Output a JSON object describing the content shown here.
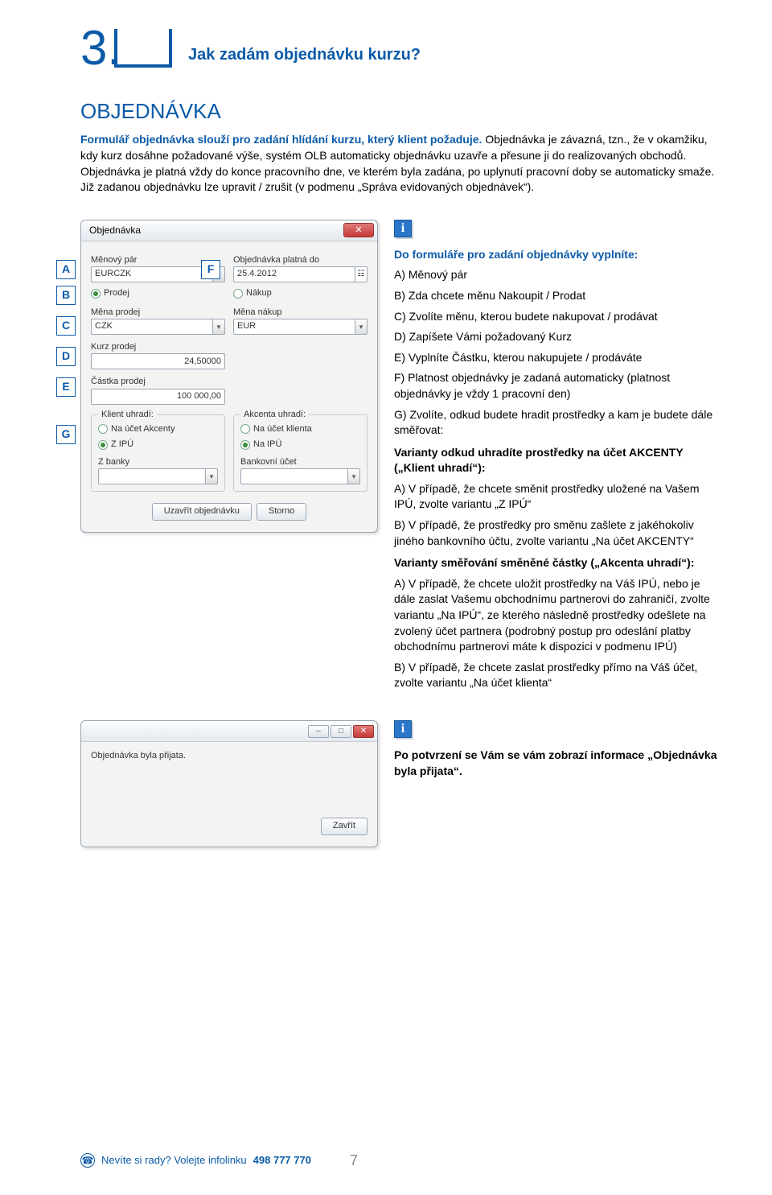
{
  "chapter": {
    "number": "3.",
    "title": "Jak zadám objednávku kurzu?"
  },
  "section": {
    "title": "OBJEDNÁVKA",
    "lead": "Formulář objednávka slouží pro zadání hlídání kurzu, který klient požaduje.",
    "body": "Objednávka je závazná, tzn., že v okamžiku, kdy kurz dosáhne požadované výše, systém OLB automaticky objednávku uzavře a přesune ji do realizovaných obchodů. Objednávka je platná vždy do konce pracovního dne, ve kterém byla zadána, po uplynutí pracovní doby se automaticky smaže. Již zadanou objednávku lze upravit / zrušit (v podmenu „Správa evidovaných objednávek“)."
  },
  "callouts": [
    "A",
    "B",
    "C",
    "D",
    "E",
    "F",
    "G"
  ],
  "dialog": {
    "title": "Objednávka",
    "labels": {
      "pair": "Měnový pár",
      "valid_to": "Objednávka platná do",
      "sell": "Prodej",
      "buy": "Nákup",
      "sell_ccy": "Měna prodej",
      "buy_ccy": "Měna nákup",
      "sell_rate": "Kurz prodej",
      "sell_amt": "Částka prodej",
      "client_pays": "Klient uhradí:",
      "akcenta_pays": "Akcenta uhradí:",
      "to_akcenta": "Na účet Akcenty",
      "from_ipu": "Z IPÚ",
      "to_client": "Na účet klienta",
      "to_ipu": "Na IPÚ",
      "from_bank": "Z banky",
      "bank_acct": "Bankovní účet",
      "submit": "Uzavřít objednávku",
      "cancel": "Storno"
    },
    "values": {
      "pair": "EURCZK",
      "valid_to": "25.4.2012",
      "sell_ccy": "CZK",
      "buy_ccy": "EUR",
      "sell_rate": "24,50000",
      "sell_amt": "100 000,00"
    }
  },
  "info": {
    "heading": "Do formuláře pro zadání objednávky vyplníte:",
    "items": [
      "A) Měnový pár",
      "B) Zda chcete měnu Nakoupit / Prodat",
      "C) Zvolíte měnu, kterou budete nakupovat / prodávat",
      "D) Zapíšete Vámi požadovaný Kurz",
      "E) Vyplníte Částku, kterou nakupujete / prodáváte",
      "F) Platnost objednávky je zadaná automaticky (platnost objednávky je vždy 1 pracovní den)",
      "G) Zvolíte, odkud budete hradit prostředky a kam je budete dále směřovat:"
    ],
    "variants1_title": "Varianty odkud uhradíte prostředky na účet AKCENTY („Klient uhradí“):",
    "variants1": [
      "A) V případě, že chcete směnit prostředky uložené na Vašem IPÚ, zvolte variantu „Z IPÚ“",
      "B) V případě, že prostředky pro směnu zašlete z jakéhokoliv jiného bankovního účtu, zvolte variantu „Na účet AKCENTY“"
    ],
    "variants2_title": "Varianty směřování směněné částky („Akcenta uhradí“):",
    "variants2": [
      "A) V případě, že chcete uložit prostředky na Váš IPÚ, nebo je dále zaslat Vašemu obchodnímu partnerovi do zahraničí, zvolte variantu „Na IPÚ“, ze kterého následně prostředky odešlete na zvolený účet partnera (podrobný postup pro odeslání platby obchodnímu partnerovi máte k dispozici v podmenu IPÚ)",
      "B) V případě, že chcete zaslat prostředky přímo na Váš účet, zvolte variantu „Na účet klienta“"
    ]
  },
  "confirm": {
    "message": "Objednávka byla přijata.",
    "close": "Zavřít",
    "info": "Po potvrzení se Vám se vám zobrazí informace „Objednávka byla přijata“."
  },
  "footer": {
    "text": "Nevíte si rady? Volejte infolinku ",
    "phone": "498 777 770",
    "page": "7"
  }
}
